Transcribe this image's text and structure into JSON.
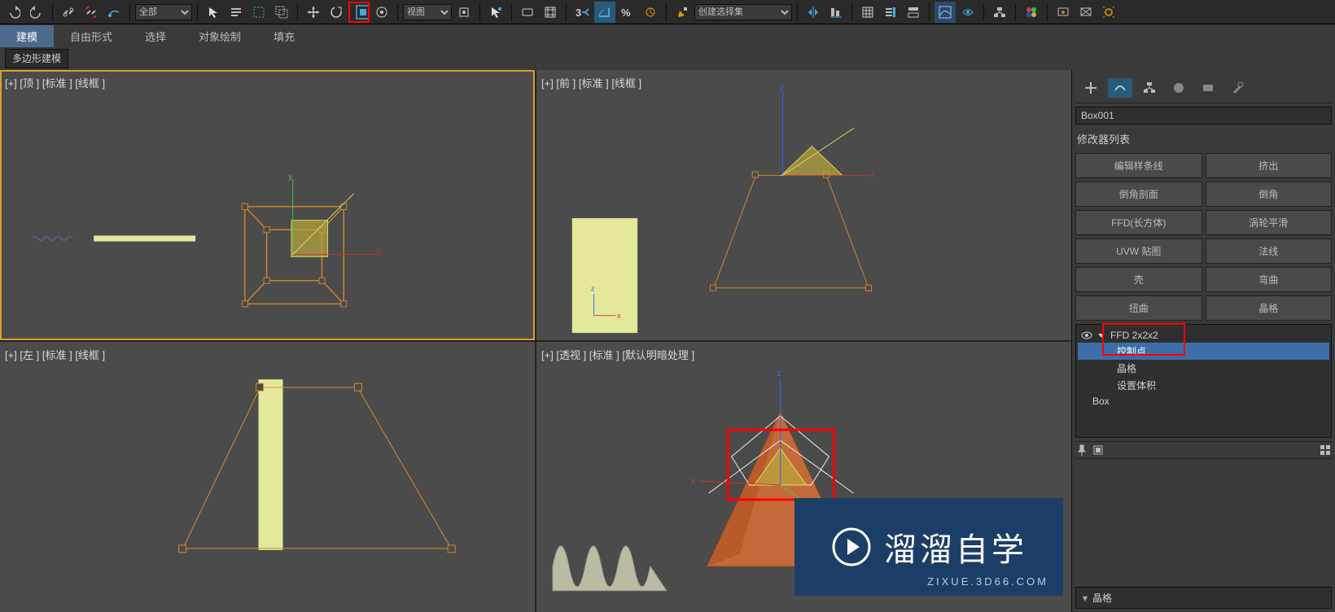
{
  "toolbar": {
    "filter_dropdown": "全部",
    "view_dropdown": "视图",
    "selection_set_placeholder": "创建选择集"
  },
  "tabs": [
    "建模",
    "自由形式",
    "选择",
    "对象绘制",
    "填充"
  ],
  "active_tab": 0,
  "subtab": "多边形建模",
  "viewports": [
    {
      "label": "[+] [顶 ] [标准 ] [线框 ]"
    },
    {
      "label": "[+] [前 ] [标准 ] [线框 ]"
    },
    {
      "label": "[+] [左 ] [标准 ] [线框 ]"
    },
    {
      "label": "[+] [透视 ] [标准 ] [默认明暗处理 ]"
    }
  ],
  "side": {
    "object_name": "Box001",
    "modifier_list_label": "修改器列表",
    "mod_buttons": [
      "编辑样条线",
      "挤出",
      "倒角剖面",
      "倒角",
      "FFD(长方体)",
      "涡轮平滑",
      "UVW 贴图",
      "法线",
      "壳",
      "弯曲",
      "扭曲",
      "晶格"
    ],
    "stack": {
      "ffd": "FFD 2x2x2",
      "sub_control": "控制点",
      "sub_lattice": "晶格",
      "sub_volume": "设置体积",
      "base": "Box"
    },
    "rollout_label": "晶格"
  },
  "watermark": {
    "title": "溜溜自学",
    "url": "ZIXUE.3D66.COM"
  }
}
